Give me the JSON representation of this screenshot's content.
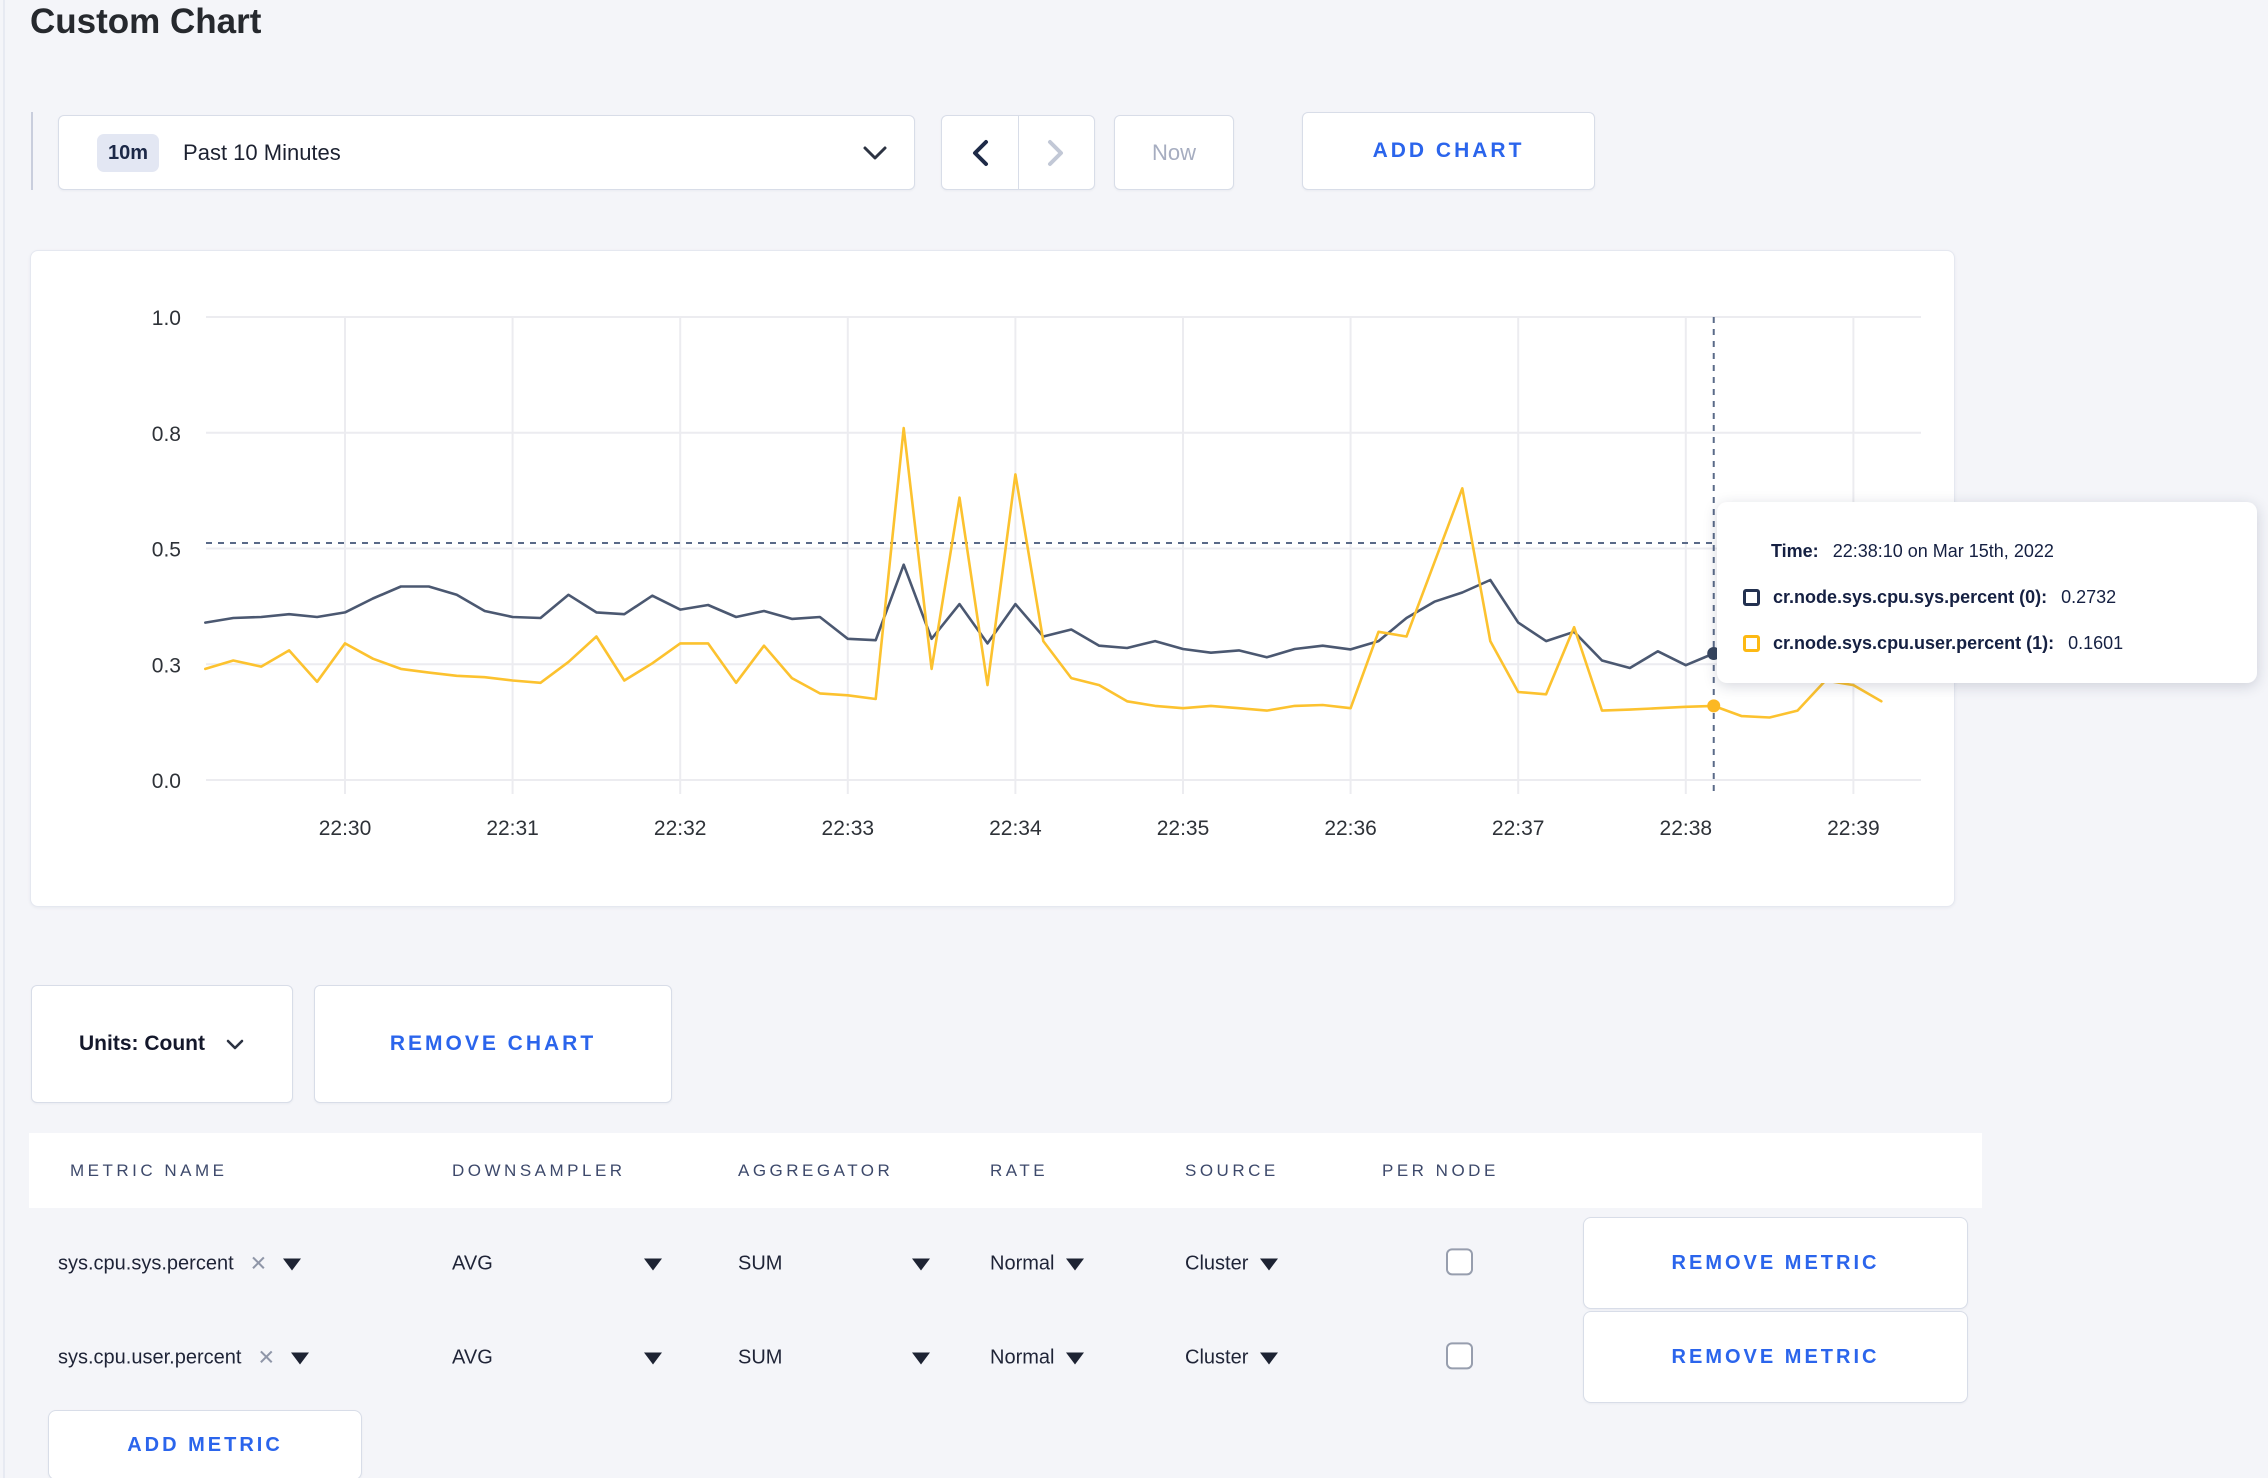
{
  "page": {
    "title": "Custom Chart"
  },
  "toolbar": {
    "time_badge": "10m",
    "time_range_label": "Past 10 Minutes",
    "now_label": "Now",
    "add_chart_label": "ADD CHART"
  },
  "tooltip": {
    "time_label": "Time:",
    "time_value": "22:38:10 on Mar 15th, 2022",
    "rows": [
      {
        "name": "cr.node.sys.cpu.sys.percent (0):",
        "value": "0.2732",
        "swatch_color": "#233150"
      },
      {
        "name": "cr.node.sys.cpu.user.percent (1):",
        "value": "0.1601",
        "swatch_color": "#fdb913"
      }
    ]
  },
  "controls": {
    "units_label": "Units: Count",
    "remove_chart_label": "REMOVE CHART",
    "add_metric_label": "ADD METRIC"
  },
  "table": {
    "headers": [
      "METRIC NAME",
      "DOWNSAMPLER",
      "AGGREGATOR",
      "RATE",
      "SOURCE",
      "PER NODE"
    ],
    "remove_metric_label": "REMOVE METRIC",
    "rows": [
      {
        "metric": "sys.cpu.sys.percent",
        "downsampler": "AVG",
        "aggregator": "SUM",
        "rate": "Normal",
        "source": "Cluster",
        "per_node_checked": false
      },
      {
        "metric": "sys.cpu.user.percent",
        "downsampler": "AVG",
        "aggregator": "SUM",
        "rate": "Normal",
        "source": "Cluster",
        "per_node_checked": false
      }
    ]
  },
  "chart_data": {
    "type": "line",
    "title": "",
    "x_ticks": [
      "22:30",
      "22:31",
      "22:32",
      "22:33",
      "22:34",
      "22:35",
      "22:36",
      "22:37",
      "22:38",
      "22:39"
    ],
    "y_ticks": [
      {
        "label": "0.0",
        "value": 0
      },
      {
        "label": "0.3",
        "value": 0.25
      },
      {
        "label": "0.5",
        "value": 0.5
      },
      {
        "label": "0.8",
        "value": 0.75
      },
      {
        "label": "1.0",
        "value": 1.0
      }
    ],
    "ylim": [
      0,
      1
    ],
    "grid": true,
    "start_time": "22:29:10",
    "interval_seconds": 10,
    "series": [
      {
        "name": "cr.node.sys.cpu.sys.percent",
        "color": "#4b5871",
        "marker_color": "#37465f",
        "values": [
          0.34,
          0.35,
          0.352,
          0.358,
          0.352,
          0.362,
          0.392,
          0.418,
          0.418,
          0.4,
          0.365,
          0.352,
          0.35,
          0.4,
          0.362,
          0.358,
          0.398,
          0.368,
          0.378,
          0.352,
          0.365,
          0.348,
          0.352,
          0.305,
          0.302,
          0.465,
          0.305,
          0.38,
          0.295,
          0.38,
          0.31,
          0.325,
          0.29,
          0.285,
          0.3,
          0.283,
          0.275,
          0.28,
          0.265,
          0.283,
          0.29,
          0.282,
          0.3,
          0.35,
          0.385,
          0.405,
          0.432,
          0.34,
          0.3,
          0.32,
          0.258,
          0.242,
          0.278,
          0.248,
          0.2732,
          0.262,
          0.27,
          0.28,
          0.268,
          0.275,
          0.272
        ]
      },
      {
        "name": "cr.node.sys.cpu.user.percent",
        "color": "#fcc22f",
        "marker_color": "#fcb823",
        "values": [
          0.24,
          0.258,
          0.245,
          0.28,
          0.212,
          0.295,
          0.262,
          0.24,
          0.232,
          0.225,
          0.222,
          0.215,
          0.21,
          0.255,
          0.31,
          0.215,
          0.252,
          0.295,
          0.295,
          0.21,
          0.29,
          0.22,
          0.187,
          0.183,
          0.175,
          0.76,
          0.24,
          0.61,
          0.205,
          0.66,
          0.3,
          0.22,
          0.205,
          0.17,
          0.16,
          0.155,
          0.16,
          0.155,
          0.15,
          0.16,
          0.162,
          0.155,
          0.32,
          0.31,
          0.47,
          0.63,
          0.3,
          0.19,
          0.185,
          0.33,
          0.15,
          0.152,
          0.155,
          0.158,
          0.1601,
          0.138,
          0.135,
          0.15,
          0.215,
          0.205,
          0.17
        ]
      }
    ],
    "crosshair": {
      "time": "22:38:10",
      "seconds_from_start": 540,
      "y_value": 0.512,
      "markers": [
        {
          "series": 0,
          "value": 0.2732
        },
        {
          "series": 1,
          "value": 0.1601
        }
      ]
    },
    "legend_position": "tooltip"
  }
}
